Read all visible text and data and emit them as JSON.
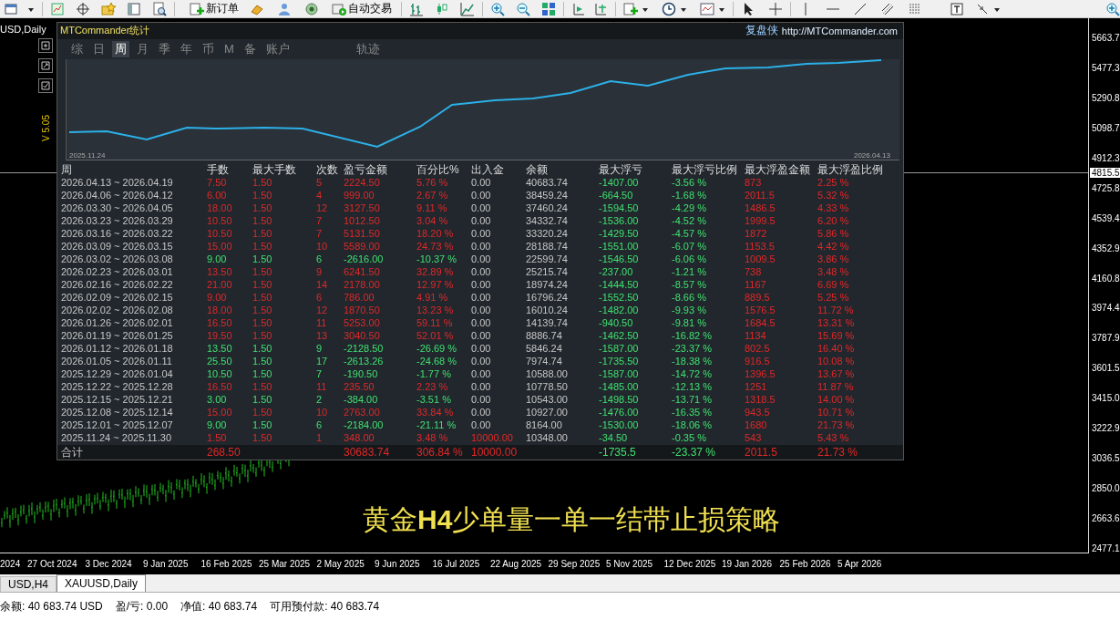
{
  "toolbar": {
    "new_order": "新订单",
    "auto_trading": "自动交易"
  },
  "chart": {
    "symbol_label": "USD,Daily",
    "version": "V 5.05",
    "current_price": "4815.5",
    "price_axis": [
      "5663.7",
      "5477.3",
      "5290.8",
      "5098.7",
      "4912.3",
      "4725.8",
      "4539.4",
      "4352.9",
      "4160.8",
      "3974.4",
      "3787.9",
      "3601.5",
      "3415.0",
      "3222.9",
      "3036.5",
      "2850.0",
      "2663.6",
      "2477.1"
    ],
    "time_axis": [
      "2024",
      "27 Oct 2024",
      "3 Dec 2024",
      "9 Jan 2025",
      "16 Feb 2025",
      "25 Mar 2025",
      "2 May 2025",
      "9 Jun 2025",
      "16 Jul 2025",
      "22 Aug 2025",
      "29 Sep 2025",
      "5 Nov 2025",
      "12 Dec 2025",
      "19 Jan 2026",
      "25 Feb 2026",
      "5 Apr 2026"
    ],
    "caption": "黄金**H4**少单量一单一结带止损策略"
  },
  "panel": {
    "title": "MTCommander统计",
    "brand": "复盘侠",
    "link": "http://MTCommander.com",
    "tabs": [
      {
        "label": "综",
        "selected": false
      },
      {
        "label": "日",
        "selected": false
      },
      {
        "label": "周",
        "selected": true
      },
      {
        "label": "月",
        "selected": false
      },
      {
        "label": "季",
        "selected": false
      },
      {
        "label": "年",
        "selected": false
      },
      {
        "label": "币",
        "selected": false
      },
      {
        "label": "M",
        "selected": false
      },
      {
        "label": "备",
        "selected": false
      },
      {
        "label": "账户",
        "selected": false
      }
    ],
    "trail_tab": {
      "label": "轨迹",
      "selected": false
    },
    "equity_start": "2025.11.24",
    "equity_end": "2026.04.13",
    "columns": [
      "周",
      "手数",
      "最大手数",
      "次数",
      "盈亏金额",
      "百分比%",
      "出入金",
      "余额",
      "最大浮亏",
      "最大浮亏比例",
      "最大浮盈金额",
      "最大浮盈比例"
    ],
    "rows": [
      {
        "kind": "profit",
        "week": "2026.04.13 ~ 2026.04.19",
        "lots": "7.50",
        "max_lots": "1.50",
        "trades": "5",
        "pl": "2224.50",
        "pct": "5.76 %",
        "deposit": "0.00",
        "deposit_in": false,
        "balance": "40683.74",
        "max_float_loss": "-1407.00",
        "max_float_loss_pct": "-3.56 %",
        "max_float_profit": "873",
        "max_float_profit_pct": "2.25 %"
      },
      {
        "kind": "profit",
        "week": "2026.04.06 ~ 2026.04.12",
        "lots": "6.00",
        "max_lots": "1.50",
        "trades": "4",
        "pl": "999.00",
        "pct": "2.67 %",
        "deposit": "0.00",
        "deposit_in": false,
        "balance": "38459.24",
        "max_float_loss": "-664.50",
        "max_float_loss_pct": "-1.68 %",
        "max_float_profit": "2011.5",
        "max_float_profit_pct": "5.32 %"
      },
      {
        "kind": "profit",
        "week": "2026.03.30 ~ 2026.04.05",
        "lots": "18.00",
        "max_lots": "1.50",
        "trades": "12",
        "pl": "3127.50",
        "pct": "9.11 %",
        "deposit": "0.00",
        "deposit_in": false,
        "balance": "37460.24",
        "max_float_loss": "-1594.50",
        "max_float_loss_pct": "-4.29 %",
        "max_float_profit": "1486.5",
        "max_float_profit_pct": "4.33 %"
      },
      {
        "kind": "profit",
        "week": "2026.03.23 ~ 2026.03.29",
        "lots": "10.50",
        "max_lots": "1.50",
        "trades": "7",
        "pl": "1012.50",
        "pct": "3.04 %",
        "deposit": "0.00",
        "deposit_in": false,
        "balance": "34332.74",
        "max_float_loss": "-1536.00",
        "max_float_loss_pct": "-4.52 %",
        "max_float_profit": "1999.5",
        "max_float_profit_pct": "6.20 %"
      },
      {
        "kind": "profit",
        "week": "2026.03.16 ~ 2026.03.22",
        "lots": "10.50",
        "max_lots": "1.50",
        "trades": "7",
        "pl": "5131.50",
        "pct": "18.20 %",
        "deposit": "0.00",
        "deposit_in": false,
        "balance": "33320.24",
        "max_float_loss": "-1429.50",
        "max_float_loss_pct": "-4.57 %",
        "max_float_profit": "1872",
        "max_float_profit_pct": "5.86 %"
      },
      {
        "kind": "profit",
        "week": "2026.03.09 ~ 2026.03.15",
        "lots": "15.00",
        "max_lots": "1.50",
        "trades": "10",
        "pl": "5589.00",
        "pct": "24.73 %",
        "deposit": "0.00",
        "deposit_in": false,
        "balance": "28188.74",
        "max_float_loss": "-1551.00",
        "max_float_loss_pct": "-6.07 %",
        "max_float_profit": "1153.5",
        "max_float_profit_pct": "4.42 %"
      },
      {
        "kind": "loss",
        "week": "2026.03.02 ~ 2026.03.08",
        "lots": "9.00",
        "max_lots": "1.50",
        "trades": "6",
        "pl": "-2616.00",
        "pct": "-10.37 %",
        "deposit": "0.00",
        "deposit_in": false,
        "balance": "22599.74",
        "max_float_loss": "-1546.50",
        "max_float_loss_pct": "-6.06 %",
        "max_float_profit": "1009.5",
        "max_float_profit_pct": "3.86 %"
      },
      {
        "kind": "profit",
        "week": "2026.02.23 ~ 2026.03.01",
        "lots": "13.50",
        "max_lots": "1.50",
        "trades": "9",
        "pl": "6241.50",
        "pct": "32.89 %",
        "deposit": "0.00",
        "deposit_in": false,
        "balance": "25215.74",
        "max_float_loss": "-237.00",
        "max_float_loss_pct": "-1.21 %",
        "max_float_profit": "738",
        "max_float_profit_pct": "3.48 %"
      },
      {
        "kind": "profit",
        "week": "2026.02.16 ~ 2026.02.22",
        "lots": "21.00",
        "max_lots": "1.50",
        "trades": "14",
        "pl": "2178.00",
        "pct": "12.97 %",
        "deposit": "0.00",
        "deposit_in": false,
        "balance": "18974.24",
        "max_float_loss": "-1444.50",
        "max_float_loss_pct": "-8.57 %",
        "max_float_profit": "1167",
        "max_float_profit_pct": "6.69 %"
      },
      {
        "kind": "profit",
        "week": "2026.02.09 ~ 2026.02.15",
        "lots": "9.00",
        "max_lots": "1.50",
        "trades": "6",
        "pl": "786.00",
        "pct": "4.91 %",
        "deposit": "0.00",
        "deposit_in": false,
        "balance": "16796.24",
        "max_float_loss": "-1552.50",
        "max_float_loss_pct": "-8.66 %",
        "max_float_profit": "889.5",
        "max_float_profit_pct": "5.25 %"
      },
      {
        "kind": "profit",
        "week": "2026.02.02 ~ 2026.02.08",
        "lots": "18.00",
        "max_lots": "1.50",
        "trades": "12",
        "pl": "1870.50",
        "pct": "13.23 %",
        "deposit": "0.00",
        "deposit_in": false,
        "balance": "16010.24",
        "max_float_loss": "-1482.00",
        "max_float_loss_pct": "-9.93 %",
        "max_float_profit": "1576.5",
        "max_float_profit_pct": "11.72 %"
      },
      {
        "kind": "profit",
        "week": "2026.01.26 ~ 2026.02.01",
        "lots": "16.50",
        "max_lots": "1.50",
        "trades": "11",
        "pl": "5253.00",
        "pct": "59.11 %",
        "deposit": "0.00",
        "deposit_in": false,
        "balance": "14139.74",
        "max_float_loss": "-940.50",
        "max_float_loss_pct": "-9.81 %",
        "max_float_profit": "1684.5",
        "max_float_profit_pct": "13.31 %"
      },
      {
        "kind": "profit",
        "week": "2026.01.19 ~ 2026.01.25",
        "lots": "19.50",
        "max_lots": "1.50",
        "trades": "13",
        "pl": "3040.50",
        "pct": "52.01 %",
        "deposit": "0.00",
        "deposit_in": false,
        "balance": "8886.74",
        "max_float_loss": "-1462.50",
        "max_float_loss_pct": "-16.82 %",
        "max_float_profit": "1134",
        "max_float_profit_pct": "15.69 %"
      },
      {
        "kind": "loss",
        "week": "2026.01.12 ~ 2026.01.18",
        "lots": "13.50",
        "max_lots": "1.50",
        "trades": "9",
        "pl": "-2128.50",
        "pct": "-26.69 %",
        "deposit": "0.00",
        "deposit_in": false,
        "balance": "5846.24",
        "max_float_loss": "-1587.00",
        "max_float_loss_pct": "-23.37 %",
        "max_float_profit": "802.5",
        "max_float_profit_pct": "16.40 %"
      },
      {
        "kind": "loss",
        "week": "2026.01.05 ~ 2026.01.11",
        "lots": "25.50",
        "max_lots": "1.50",
        "trades": "17",
        "pl": "-2613.26",
        "pct": "-24.68 %",
        "deposit": "0.00",
        "deposit_in": false,
        "balance": "7974.74",
        "max_float_loss": "-1735.50",
        "max_float_loss_pct": "-18.38 %",
        "max_float_profit": "916.5",
        "max_float_profit_pct": "10.08 %"
      },
      {
        "kind": "loss",
        "week": "2025.12.29 ~ 2026.01.04",
        "lots": "10.50",
        "max_lots": "1.50",
        "trades": "7",
        "pl": "-190.50",
        "pct": "-1.77 %",
        "deposit": "0.00",
        "deposit_in": false,
        "balance": "10588.00",
        "max_float_loss": "-1587.00",
        "max_float_loss_pct": "-14.72 %",
        "max_float_profit": "1396.5",
        "max_float_profit_pct": "13.67 %"
      },
      {
        "kind": "profit",
        "week": "2025.12.22 ~ 2025.12.28",
        "lots": "16.50",
        "max_lots": "1.50",
        "trades": "11",
        "pl": "235.50",
        "pct": "2.23 %",
        "deposit": "0.00",
        "deposit_in": false,
        "balance": "10778.50",
        "max_float_loss": "-1485.00",
        "max_float_loss_pct": "-12.13 %",
        "max_float_profit": "1251",
        "max_float_profit_pct": "11.87 %"
      },
      {
        "kind": "loss",
        "week": "2025.12.15 ~ 2025.12.21",
        "lots": "3.00",
        "max_lots": "1.50",
        "trades": "2",
        "pl": "-384.00",
        "pct": "-3.51 %",
        "deposit": "0.00",
        "deposit_in": false,
        "balance": "10543.00",
        "max_float_loss": "-1498.50",
        "max_float_loss_pct": "-13.71 %",
        "max_float_profit": "1318.5",
        "max_float_profit_pct": "14.00 %"
      },
      {
        "kind": "profit",
        "week": "2025.12.08 ~ 2025.12.14",
        "lots": "15.00",
        "max_lots": "1.50",
        "trades": "10",
        "pl": "2763.00",
        "pct": "33.84 %",
        "deposit": "0.00",
        "deposit_in": false,
        "balance": "10927.00",
        "max_float_loss": "-1476.00",
        "max_float_loss_pct": "-16.35 %",
        "max_float_profit": "943.5",
        "max_float_profit_pct": "10.71 %"
      },
      {
        "kind": "loss",
        "week": "2025.12.01 ~ 2025.12.07",
        "lots": "9.00",
        "max_lots": "1.50",
        "trades": "6",
        "pl": "-2184.00",
        "pct": "-21.11 %",
        "deposit": "0.00",
        "deposit_in": false,
        "balance": "8164.00",
        "max_float_loss": "-1530.00",
        "max_float_loss_pct": "-18.06 %",
        "max_float_profit": "1680",
        "max_float_profit_pct": "21.73 %"
      },
      {
        "kind": "profit",
        "week": "2025.11.24 ~ 2025.11.30",
        "lots": "1.50",
        "max_lots": "1.50",
        "trades": "1",
        "pl": "348.00",
        "pct": "3.48 %",
        "deposit": "10000.00",
        "deposit_in": true,
        "balance": "10348.00",
        "max_float_loss": "-34.50",
        "max_float_loss_pct": "-0.35 %",
        "max_float_profit": "543",
        "max_float_profit_pct": "5.43 %"
      }
    ],
    "total": {
      "label": "合计",
      "lots": "268.50",
      "pl": "30683.74",
      "pct": "306.84 %",
      "deposit": "10000.00",
      "max_float_loss": "-1735.5",
      "max_float_loss_pct": "-23.37 %",
      "max_float_profit": "2011.5",
      "max_float_profit_pct": "21.73 %"
    }
  },
  "chart_tabs": [
    {
      "label": "USD,H4",
      "selected": false
    },
    {
      "label": "XAUUSD,Daily",
      "selected": true
    }
  ],
  "status_bar": [
    "余额: 40 683.74 USD",
    "盈/亏: 0.00",
    "净值: 40 683.74",
    "可用预付款: 40 683.74"
  ]
}
